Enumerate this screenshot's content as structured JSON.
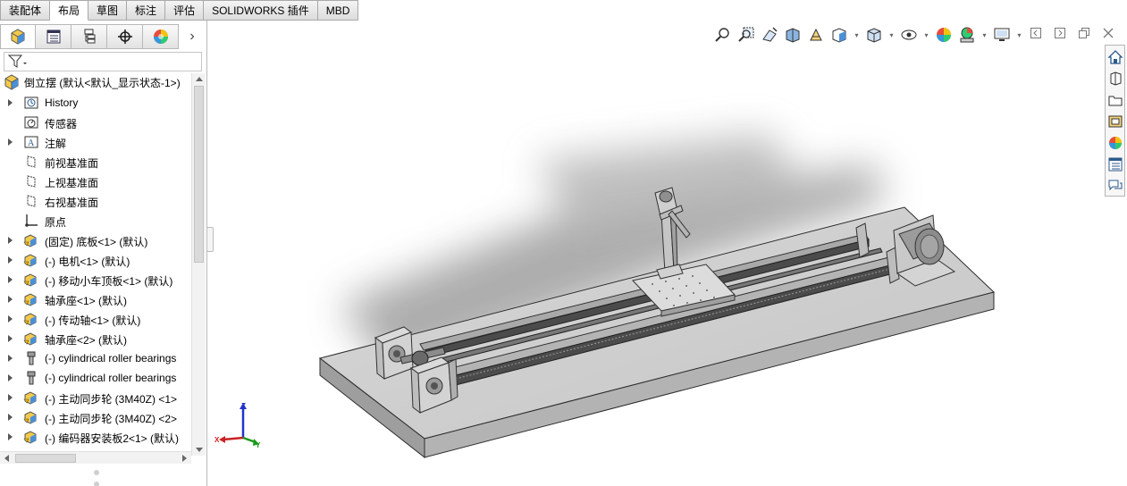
{
  "command_tabs": [
    "装配体",
    "布局",
    "草图",
    "标注",
    "评估",
    "SOLIDWORKS 插件",
    "MBD"
  ],
  "active_command_tab": "布局",
  "feature_tabs": [
    "featuremanager-tree-icon",
    "property-manager-icon",
    "configuration-manager-icon",
    "dimxpert-icon",
    "display-manager-icon"
  ],
  "feature_tree": {
    "root_label": "倒立摆 (默认<默认_显示状态-1>)",
    "items": [
      {
        "label": "History",
        "icon": "history-folder-icon",
        "expandable": true
      },
      {
        "label": "传感器",
        "icon": "sensor-icon",
        "expandable": false
      },
      {
        "label": "注解",
        "icon": "annotation-icon",
        "expandable": true
      },
      {
        "label": "前视基准面",
        "icon": "plane-icon",
        "expandable": false
      },
      {
        "label": "上视基准面",
        "icon": "plane-icon",
        "expandable": false
      },
      {
        "label": "右视基准面",
        "icon": "plane-icon",
        "expandable": false
      },
      {
        "label": "原点",
        "icon": "origin-icon",
        "expandable": false
      },
      {
        "label": "(固定) 底板<1> (默认)",
        "icon": "part-icon",
        "expandable": true
      },
      {
        "label": "(-) 电机<1> (默认)",
        "icon": "part-icon",
        "expandable": true
      },
      {
        "label": "(-) 移动小车顶板<1> (默认)",
        "icon": "part-icon",
        "expandable": true
      },
      {
        "label": "轴承座<1> (默认)",
        "icon": "part-icon",
        "expandable": true
      },
      {
        "label": "(-) 传动轴<1> (默认)",
        "icon": "part-icon",
        "expandable": true
      },
      {
        "label": "轴承座<2> (默认)",
        "icon": "part-icon",
        "expandable": true
      },
      {
        "label": "(-) cylindrical roller bearings",
        "icon": "toolbox-part-icon",
        "expandable": true
      },
      {
        "label": "(-) cylindrical roller bearings",
        "icon": "toolbox-part-icon",
        "expandable": true
      },
      {
        "label": "(-) 主动同步轮 (3M40Z) <1>",
        "icon": "part-icon",
        "expandable": true
      },
      {
        "label": "(-) 主动同步轮 (3M40Z) <2>",
        "icon": "part-icon",
        "expandable": true
      },
      {
        "label": "(-) 编码器安装板2<1> (默认)",
        "icon": "part-icon",
        "expandable": true
      }
    ]
  },
  "heads_up_toolbar": [
    "zoom-to-fit-icon",
    "zoom-to-area-icon",
    "previous-view-icon",
    "section-view-icon",
    "dynamic-annotation-icon",
    "view-orientation-icon",
    "display-style-icon",
    "hide-show-items-icon",
    "edit-appearance-icon",
    "apply-scene-icon",
    "view-settings-icon"
  ],
  "task_pane": [
    "home-icon",
    "design-library-icon",
    "file-explorer-icon",
    "view-palette-icon",
    "appearances-icon",
    "custom-properties-icon",
    "forum-icon"
  ],
  "triad_axes": {
    "z": "Z",
    "x": "X",
    "y": "Y"
  }
}
